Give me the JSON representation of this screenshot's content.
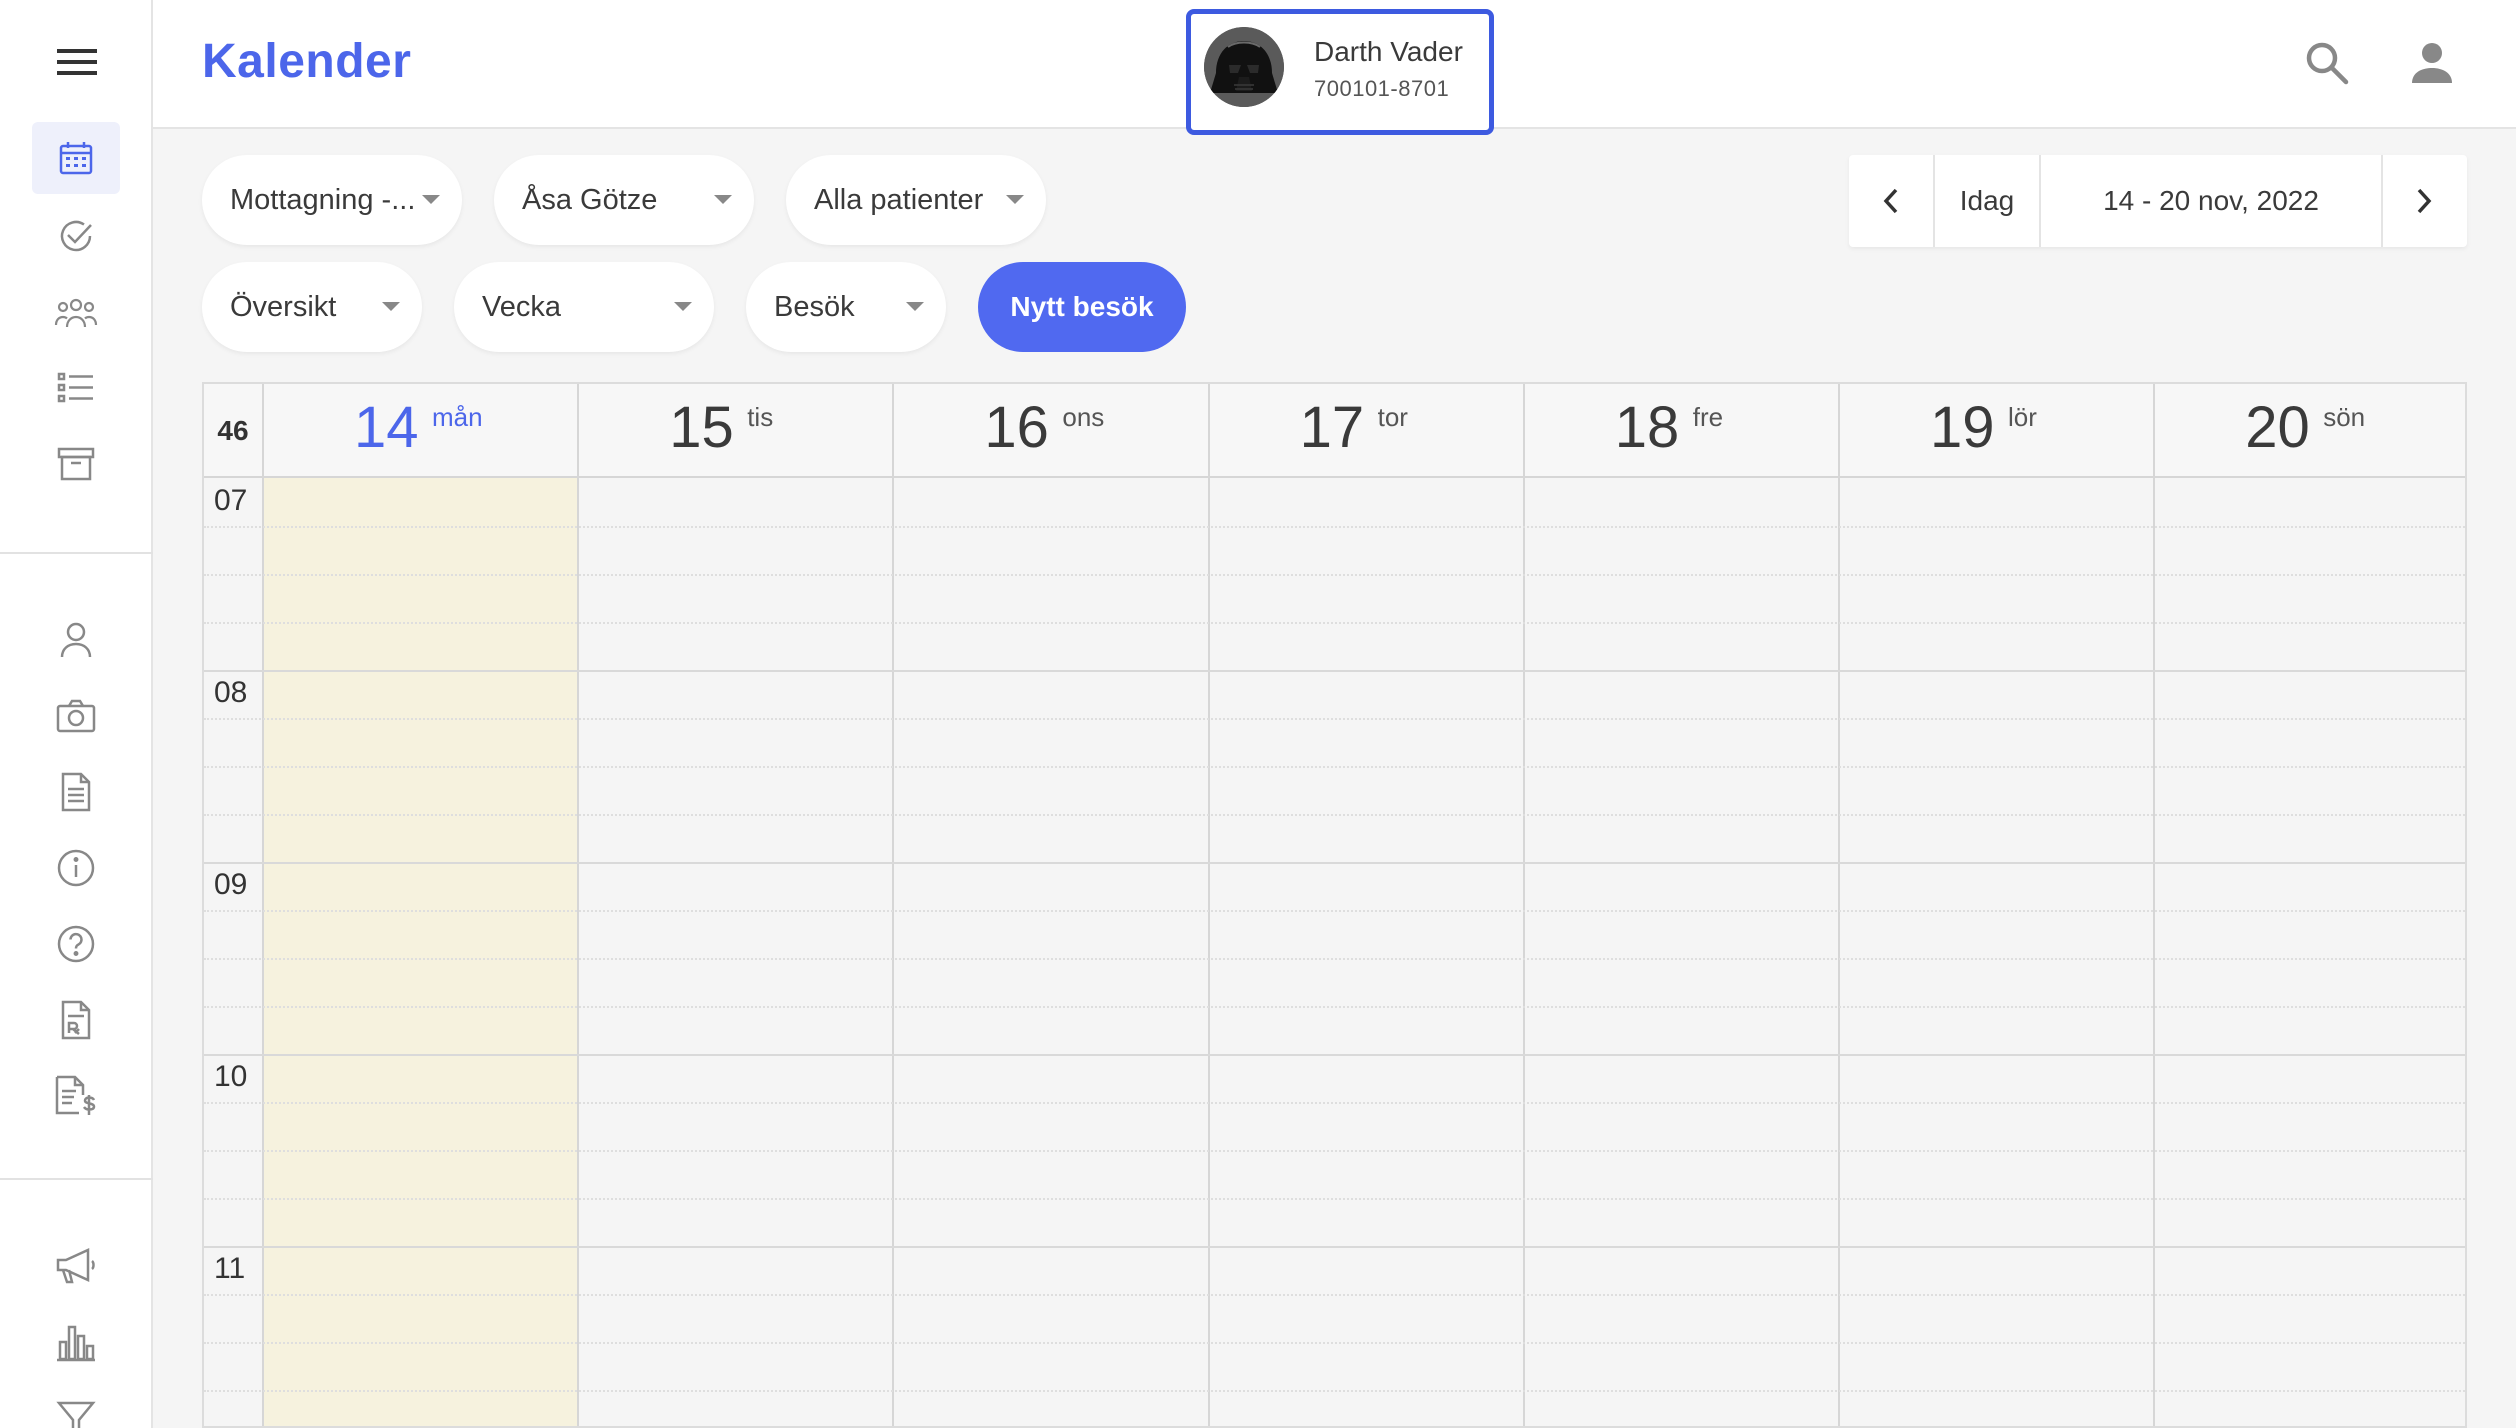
{
  "header": {
    "title": "Kalender",
    "patient": {
      "name": "Darth Vader",
      "id": "700101-8701"
    }
  },
  "sidebar": {
    "top_items": [
      "calendar-icon",
      "check-circle-icon",
      "group-icon",
      "list-icon",
      "archive-icon"
    ],
    "middle_items": [
      "person-icon",
      "camera-icon",
      "document-icon",
      "info-icon",
      "help-icon",
      "prescription-icon",
      "invoice-icon"
    ],
    "bottom_items": [
      "megaphone-icon",
      "bar-chart-icon",
      "filter-icon"
    ]
  },
  "filters": {
    "reception": "Mottagning -...",
    "caregiver": "Åsa Götze",
    "patients": "Alla patienter",
    "overview": "Översikt",
    "period": "Vecka",
    "type": "Besök",
    "new_visit": "Nytt besök"
  },
  "date_nav": {
    "today": "Idag",
    "range": "14 - 20 nov, 2022"
  },
  "calendar": {
    "week": "46",
    "days": [
      {
        "num": "14",
        "name": "mån",
        "today": true
      },
      {
        "num": "15",
        "name": "tis",
        "today": false
      },
      {
        "num": "16",
        "name": "ons",
        "today": false
      },
      {
        "num": "17",
        "name": "tor",
        "today": false
      },
      {
        "num": "18",
        "name": "fre",
        "today": false
      },
      {
        "num": "19",
        "name": "lör",
        "today": false
      },
      {
        "num": "20",
        "name": "sön",
        "today": false
      }
    ],
    "hours": [
      "07",
      "08",
      "09",
      "10",
      "11"
    ]
  },
  "colors": {
    "accent": "#4c66ea",
    "today_bg": "#f6f2de",
    "patient_border": "#3d5ae0"
  }
}
